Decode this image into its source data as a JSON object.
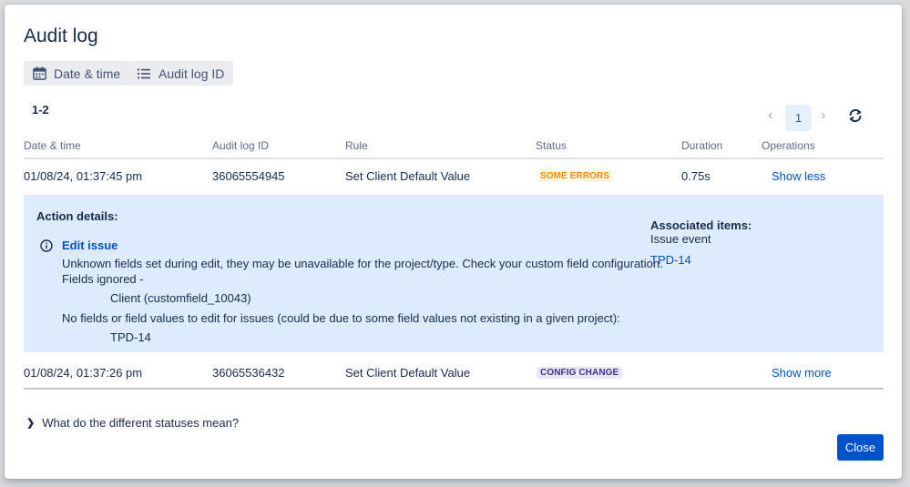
{
  "dialog": {
    "title": "Audit log"
  },
  "filters": [
    {
      "label": "Date & time",
      "icon": "calendar-icon"
    },
    {
      "label": "Audit log ID",
      "icon": "list-icon"
    }
  ],
  "pagination": {
    "range": "1-2",
    "current_page": "1",
    "prev_icon": "chevron-left-icon",
    "next_icon": "chevron-right-icon",
    "refresh_icon": "refresh-icon"
  },
  "table": {
    "columns": [
      "Date & time",
      "Audit log ID",
      "Rule",
      "Status",
      "Duration",
      "Operations"
    ],
    "rows": [
      {
        "date": "01/08/24, 01:37:45 pm",
        "id": "36065554945",
        "rule": "Set Client Default Value",
        "status": "SOME ERRORS",
        "duration": "0.75s",
        "operation": "Show less"
      },
      {
        "date": "01/08/24, 01:37:26 pm",
        "id": "36065536432",
        "rule": "Set Client Default Value",
        "status": "CONFIG CHANGE",
        "duration": "",
        "operation": "Show more"
      }
    ]
  },
  "details": {
    "heading": "Action details:",
    "action": "Edit issue",
    "lines": [
      "Unknown fields set during edit, they may be unavailable for the project/type. Check your custom field configuration.",
      "Fields ignored -",
      "Client (customfield_10043)",
      "No fields or field values to edit for issues (could be due to some field values not existing in a given project):",
      "TPD-14"
    ],
    "associated_heading": "Associated items:",
    "associated_type": "Issue event",
    "associated_link": "TPD-14"
  },
  "help": {
    "label": "What do the different statuses mean?"
  },
  "footer": {
    "close_label": "Close"
  },
  "colors": {
    "primary": "#0052cc",
    "some_errors_bg": "#fffae6",
    "some_errors_text": "#ff8b00",
    "config_change_bg": "#eae6ff",
    "config_change_text": "#403294",
    "details_bg": "#deebff"
  }
}
